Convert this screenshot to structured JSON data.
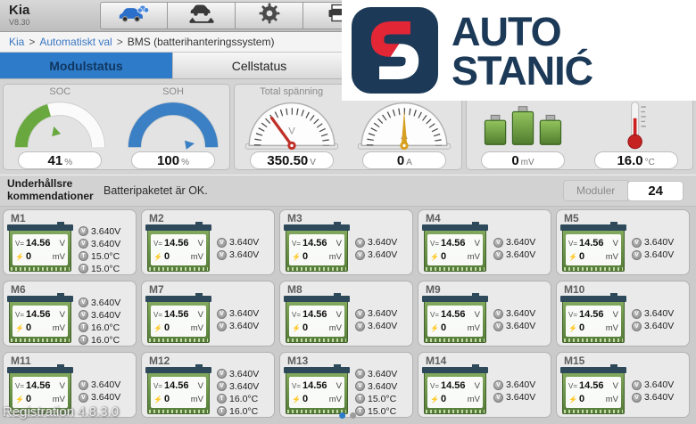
{
  "header": {
    "title": "Kia",
    "version": "V8.30",
    "toolbar": {
      "buttons": [
        {
          "id": "vehicle-connect",
          "icon": "car-cloud-icon"
        },
        {
          "id": "vehicle-lift",
          "icon": "car-lift-icon"
        },
        {
          "id": "settings",
          "icon": "gear-icon"
        },
        {
          "id": "print",
          "icon": "printer-icon"
        }
      ]
    }
  },
  "breadcrumb": {
    "home": "Kia",
    "section": "Automatiskt val",
    "current": "BMS (batterihanteringssystem)",
    "separator": ">"
  },
  "tabs": [
    {
      "label": "Modulstatus",
      "active": true
    },
    {
      "label": "Cellstatus",
      "active": false
    }
  ],
  "gauges": {
    "soc": {
      "title": "SOC",
      "value": "41",
      "unit": "%",
      "percent": 41,
      "color": "#68a83e"
    },
    "soh": {
      "title": "SOH",
      "value": "100",
      "unit": "%",
      "percent": 100,
      "color": "#3b80c4"
    },
    "total_voltage": {
      "title": "Total spänning",
      "value": "350.50",
      "unit": "V",
      "dial_letter": "V",
      "needle_color": "#c03028"
    },
    "current": {
      "value": "0",
      "unit": "A",
      "dial_letter": "A",
      "needle_color": "#d7a022"
    },
    "cell_voltage_diff": {
      "value": "0",
      "unit": "mV"
    },
    "temperature": {
      "value": "16.0",
      "unit": "°C"
    }
  },
  "recommendation": {
    "label": "Underhållsre kommendationer",
    "message": "Batteripaketet är OK.",
    "modules_label": "Moduler",
    "modules_count": "24"
  },
  "modules": [
    {
      "name": "M1",
      "voltage": "14.56",
      "voltage_unit": "V",
      "current": "0",
      "current_unit": "mV",
      "stats": [
        {
          "type": "cell-vmax",
          "value": "3.640V"
        },
        {
          "type": "cell-vmin",
          "value": "3.640V"
        },
        {
          "type": "temp-max",
          "value": "15.0°C"
        },
        {
          "type": "temp-min",
          "value": "15.0°C"
        }
      ]
    },
    {
      "name": "M2",
      "voltage": "14.56",
      "voltage_unit": "V",
      "current": "0",
      "current_unit": "mV",
      "stats": [
        {
          "type": "cell-vmax",
          "value": "3.640V"
        },
        {
          "type": "cell-vmin",
          "value": "3.640V"
        }
      ]
    },
    {
      "name": "M3",
      "voltage": "14.56",
      "voltage_unit": "V",
      "current": "0",
      "current_unit": "mV",
      "stats": [
        {
          "type": "cell-vmax",
          "value": "3.640V"
        },
        {
          "type": "cell-vmin",
          "value": "3.640V"
        }
      ]
    },
    {
      "name": "M4",
      "voltage": "14.56",
      "voltage_unit": "V",
      "current": "0",
      "current_unit": "mV",
      "stats": [
        {
          "type": "cell-vmax",
          "value": "3.640V"
        },
        {
          "type": "cell-vmin",
          "value": "3.640V"
        }
      ]
    },
    {
      "name": "M5",
      "voltage": "14.56",
      "voltage_unit": "V",
      "current": "0",
      "current_unit": "mV",
      "stats": [
        {
          "type": "cell-vmax",
          "value": "3.640V"
        },
        {
          "type": "cell-vmin",
          "value": "3.640V"
        }
      ]
    },
    {
      "name": "M6",
      "voltage": "14.56",
      "voltage_unit": "V",
      "current": "0",
      "current_unit": "mV",
      "stats": [
        {
          "type": "cell-vmax",
          "value": "3.640V"
        },
        {
          "type": "cell-vmin",
          "value": "3.640V"
        },
        {
          "type": "temp-max",
          "value": "16.0°C"
        },
        {
          "type": "temp-min",
          "value": "16.0°C"
        }
      ]
    },
    {
      "name": "M7",
      "voltage": "14.56",
      "voltage_unit": "V",
      "current": "0",
      "current_unit": "mV",
      "stats": [
        {
          "type": "cell-vmax",
          "value": "3.640V"
        },
        {
          "type": "cell-vmin",
          "value": "3.640V"
        }
      ]
    },
    {
      "name": "M8",
      "voltage": "14.56",
      "voltage_unit": "V",
      "current": "0",
      "current_unit": "mV",
      "stats": [
        {
          "type": "cell-vmax",
          "value": "3.640V"
        },
        {
          "type": "cell-vmin",
          "value": "3.640V"
        }
      ]
    },
    {
      "name": "M9",
      "voltage": "14.56",
      "voltage_unit": "V",
      "current": "0",
      "current_unit": "mV",
      "stats": [
        {
          "type": "cell-vmax",
          "value": "3.640V"
        },
        {
          "type": "cell-vmin",
          "value": "3.640V"
        }
      ]
    },
    {
      "name": "M10",
      "voltage": "14.56",
      "voltage_unit": "V",
      "current": "0",
      "current_unit": "mV",
      "stats": [
        {
          "type": "cell-vmax",
          "value": "3.640V"
        },
        {
          "type": "cell-vmin",
          "value": "3.640V"
        }
      ]
    },
    {
      "name": "M11",
      "voltage": "14.56",
      "voltage_unit": "V",
      "current": "0",
      "current_unit": "mV",
      "stats": [
        {
          "type": "cell-vmax",
          "value": "3.640V"
        },
        {
          "type": "cell-vmin",
          "value": "3.640V"
        }
      ]
    },
    {
      "name": "M12",
      "voltage": "14.56",
      "voltage_unit": "V",
      "current": "0",
      "current_unit": "mV",
      "stats": [
        {
          "type": "cell-vmax",
          "value": "3.640V"
        },
        {
          "type": "cell-vmin",
          "value": "3.640V"
        },
        {
          "type": "temp-max",
          "value": "16.0°C"
        },
        {
          "type": "temp-min",
          "value": "16.0°C"
        }
      ]
    },
    {
      "name": "M13",
      "voltage": "14.56",
      "voltage_unit": "V",
      "current": "0",
      "current_unit": "mV",
      "stats": [
        {
          "type": "cell-vmax",
          "value": "3.640V"
        },
        {
          "type": "cell-vmin",
          "value": "3.640V"
        },
        {
          "type": "temp-max",
          "value": "15.0°C"
        },
        {
          "type": "temp-min",
          "value": "15.0°C"
        }
      ]
    },
    {
      "name": "M14",
      "voltage": "14.56",
      "voltage_unit": "V",
      "current": "0",
      "current_unit": "mV",
      "stats": [
        {
          "type": "cell-vmax",
          "value": "3.640V"
        },
        {
          "type": "cell-vmin",
          "value": "3.640V"
        }
      ]
    },
    {
      "name": "M15",
      "voltage": "14.56",
      "voltage_unit": "V",
      "current": "0",
      "current_unit": "mV",
      "stats": [
        {
          "type": "cell-vmax",
          "value": "3.640V"
        },
        {
          "type": "cell-vmin",
          "value": "3.640V"
        }
      ]
    }
  ],
  "pagination": {
    "dots": 2,
    "active": 0
  },
  "footer": {
    "registration": "Registration 4.8.3.0"
  },
  "logo": {
    "line1": "AUTO",
    "line2": "STANIĆ",
    "navy": "#1c3a57",
    "red": "#e32636"
  }
}
